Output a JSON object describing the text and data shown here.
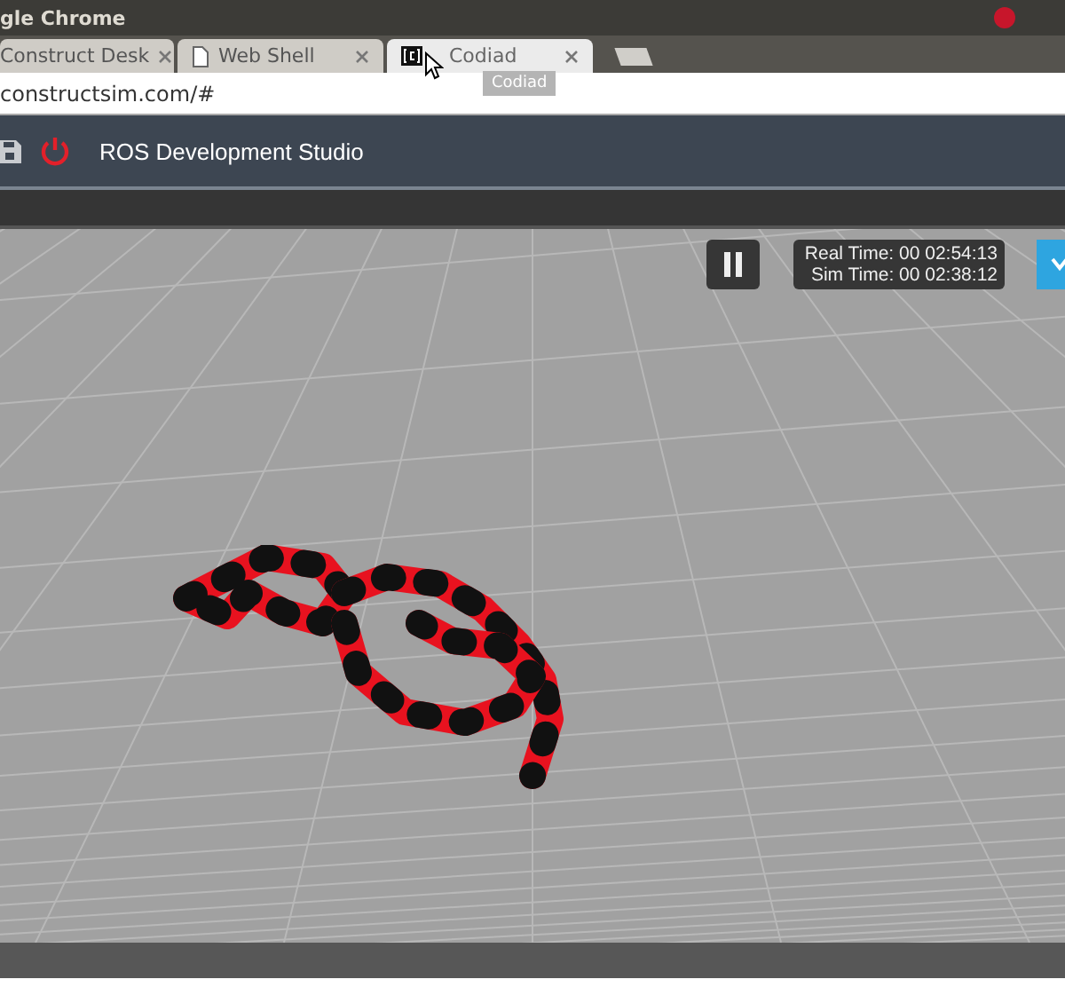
{
  "window": {
    "title": "gle Chrome"
  },
  "tabs": [
    {
      "label": "Construct Desk",
      "kind": "plain",
      "selected": false
    },
    {
      "label": "Web Shell",
      "kind": "page",
      "selected": false
    },
    {
      "label": "Codiad",
      "kind": "bracket",
      "selected": true
    }
  ],
  "tooltip": "Codiad",
  "address_bar": {
    "value": "constructsim.com/#"
  },
  "app_header": {
    "title": "ROS Development Studio"
  },
  "simulation": {
    "paused": false,
    "real_time": "Real Time: 00 02:54:13",
    "sim_time": "Sim Time: 00 02:38:12"
  }
}
